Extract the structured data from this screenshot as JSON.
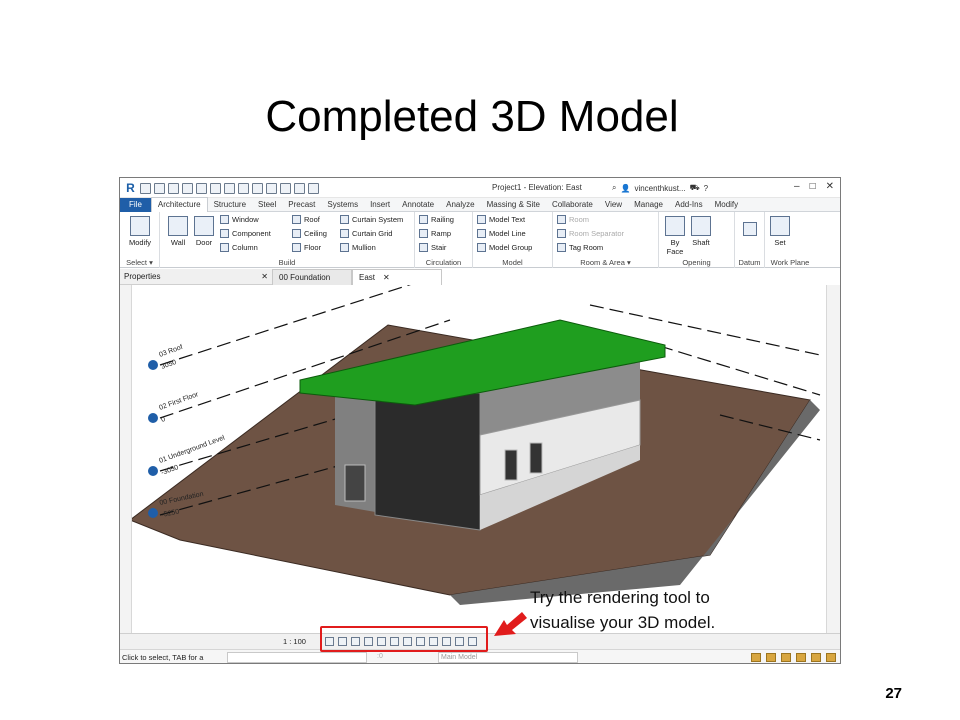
{
  "slide": {
    "title": "Completed 3D Model",
    "page_number": "27",
    "callout": [
      "Try the rendering tool to",
      "visualise your 3D model."
    ]
  },
  "app": {
    "window_title": "Project1 - Elevation: East",
    "user": "vincenthkust...",
    "tabs": [
      "File",
      "Architecture",
      "Structure",
      "Steel",
      "Precast",
      "Systems",
      "Insert",
      "Annotate",
      "Analyze",
      "Massing & Site",
      "Collaborate",
      "View",
      "Manage",
      "Add-Ins",
      "Modify"
    ],
    "active_tab": "Architecture",
    "ribbon": {
      "select": {
        "modify": "Modify",
        "label": "Select ▾"
      },
      "build": {
        "wall": "Wall",
        "door": "Door",
        "window": "Window",
        "component": "Component",
        "column": "Column",
        "roof": "Roof",
        "ceiling": "Ceiling",
        "floor": "Floor",
        "curtain_system": "Curtain System",
        "curtain_grid": "Curtain Grid",
        "mullion": "Mullion",
        "label": "Build"
      },
      "circulation": {
        "railing": "Railing",
        "ramp": "Ramp",
        "stair": "Stair",
        "label": "Circulation"
      },
      "model": {
        "model_text": "Model Text",
        "model_line": "Model Line",
        "model_group": "Model Group",
        "label": "Model"
      },
      "room_area": {
        "room": "Room",
        "room_separator": "Room Separator",
        "tag_room": "Tag Room",
        "label": "Room & Area ▾"
      },
      "opening": {
        "by_face": "By Face",
        "shaft": "Shaft",
        "label": "Opening"
      },
      "datum": {
        "label": "Datum"
      },
      "work_plane": {
        "set": "Set",
        "label": "Work Plane"
      }
    },
    "properties_title": "Properties",
    "view_tabs": [
      "00 Foundation",
      "East"
    ],
    "active_view": "East",
    "levels": [
      {
        "name": "03 Roof",
        "elevation": "3050"
      },
      {
        "name": "02 First Floor",
        "elevation": "0"
      },
      {
        "name": "01 Underground Level",
        "elevation": "-3050"
      },
      {
        "name": "00 Foundation",
        "elevation": "-5250"
      }
    ],
    "view_scale": "1 : 100",
    "status_text": "Click to select, TAB for a",
    "status_model": "Main Model",
    "status_zero": ":0"
  },
  "colors": {
    "roof": "#1f9e1f",
    "ground": "#6e5344",
    "highlight": "#e11c1c",
    "file_tab": "#1f5ea8"
  }
}
